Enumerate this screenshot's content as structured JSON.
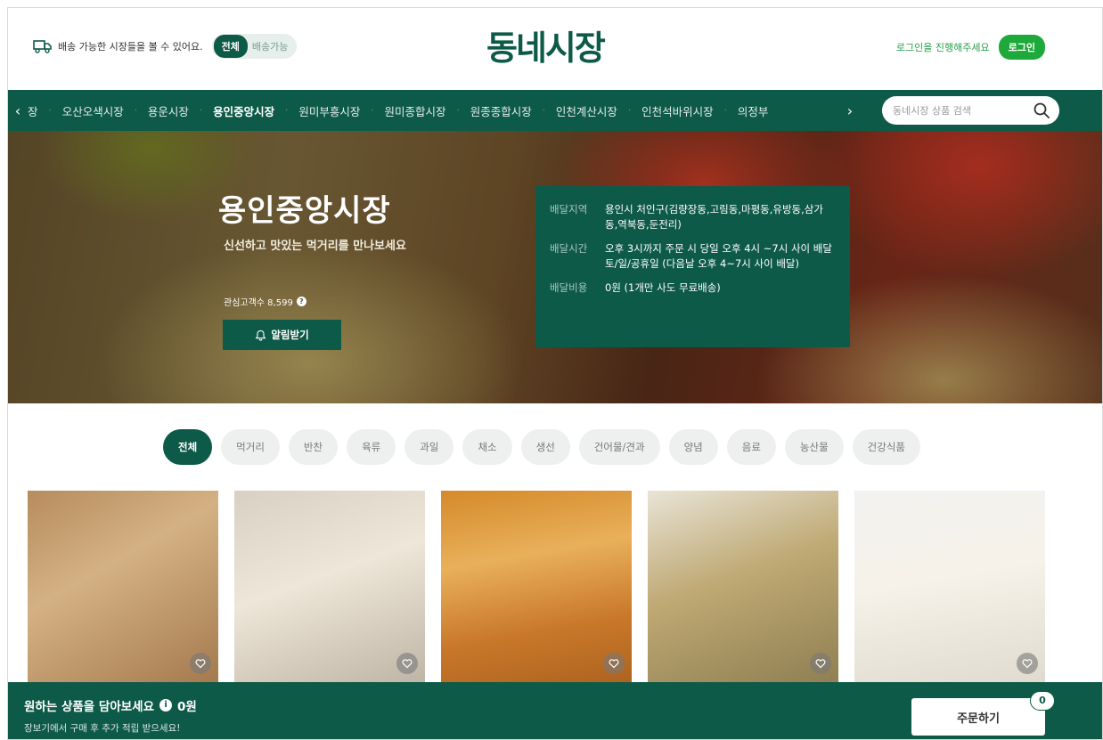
{
  "header": {
    "delivery_text": "배송 가능한 시장들을 볼 수 있어요.",
    "toggle_on": "전체",
    "toggle_off": "배송가능",
    "logo": "동네시장",
    "login_prompt": "로그인을 진행해주세요",
    "login_button": "로그인"
  },
  "nav": {
    "prev_arrow": "‹",
    "next_arrow": "›",
    "items": [
      {
        "label": "장",
        "active": false
      },
      {
        "label": "오산오색시장",
        "active": false
      },
      {
        "label": "용운시장",
        "active": false
      },
      {
        "label": "용인중앙시장",
        "active": true
      },
      {
        "label": "원미부흥시장",
        "active": false
      },
      {
        "label": "원미종합시장",
        "active": false
      },
      {
        "label": "원종종합시장",
        "active": false
      },
      {
        "label": "인천계산시장",
        "active": false
      },
      {
        "label": "인천석바위시장",
        "active": false
      },
      {
        "label": "의정부",
        "active": false
      }
    ],
    "search_placeholder": "동네시장 상품 검색"
  },
  "hero": {
    "title": "용인중앙시장",
    "subtitle": "신선하고 맛있는 먹거리를 만나보세요",
    "fans_label": "관심고객수 8,599",
    "alarm_button": "알림받기",
    "info": {
      "area_label": "배달지역",
      "area_value": "용인시 처인구(김량장동,고림동,마평동,유방동,삼가동,역북동,둔전리)",
      "time_label": "배달시간",
      "time_value_1": "오후 3시까지 주문 시 당일 오후 4시 ~7시 사이 배달",
      "time_value_2": "토/일/공휴일 (다음날 오후 4~7시 사이 배달)",
      "cost_label": "배달비용",
      "cost_value": "0원 (1개만 사도 무료배송)"
    }
  },
  "categories": [
    {
      "label": "전체",
      "active": true
    },
    {
      "label": "먹거리",
      "active": false
    },
    {
      "label": "반찬",
      "active": false
    },
    {
      "label": "육류",
      "active": false
    },
    {
      "label": "과일",
      "active": false
    },
    {
      "label": "채소",
      "active": false
    },
    {
      "label": "생선",
      "active": false
    },
    {
      "label": "건어물/견과",
      "active": false
    },
    {
      "label": "양념",
      "active": false
    },
    {
      "label": "음료",
      "active": false
    },
    {
      "label": "농산물",
      "active": false
    },
    {
      "label": "건강식품",
      "active": false
    }
  ],
  "products": [
    {
      "image": "green-white-rice-cakes"
    },
    {
      "image": "packaged-popped-rice"
    },
    {
      "image": "fried-snacks-pack"
    },
    {
      "image": "sesame-rice-sticks"
    },
    {
      "image": "colorful-rice-cakes"
    }
  ],
  "cart": {
    "message": "원하는 상품을 담아보세요",
    "total": "0원",
    "sub": "장보기에서 구매 후 추가 적립 받으세요!",
    "order_button": "주문하기",
    "count": "0"
  },
  "colors": {
    "brand_green": "#0e5a49",
    "login_green": "#1ea93b"
  }
}
